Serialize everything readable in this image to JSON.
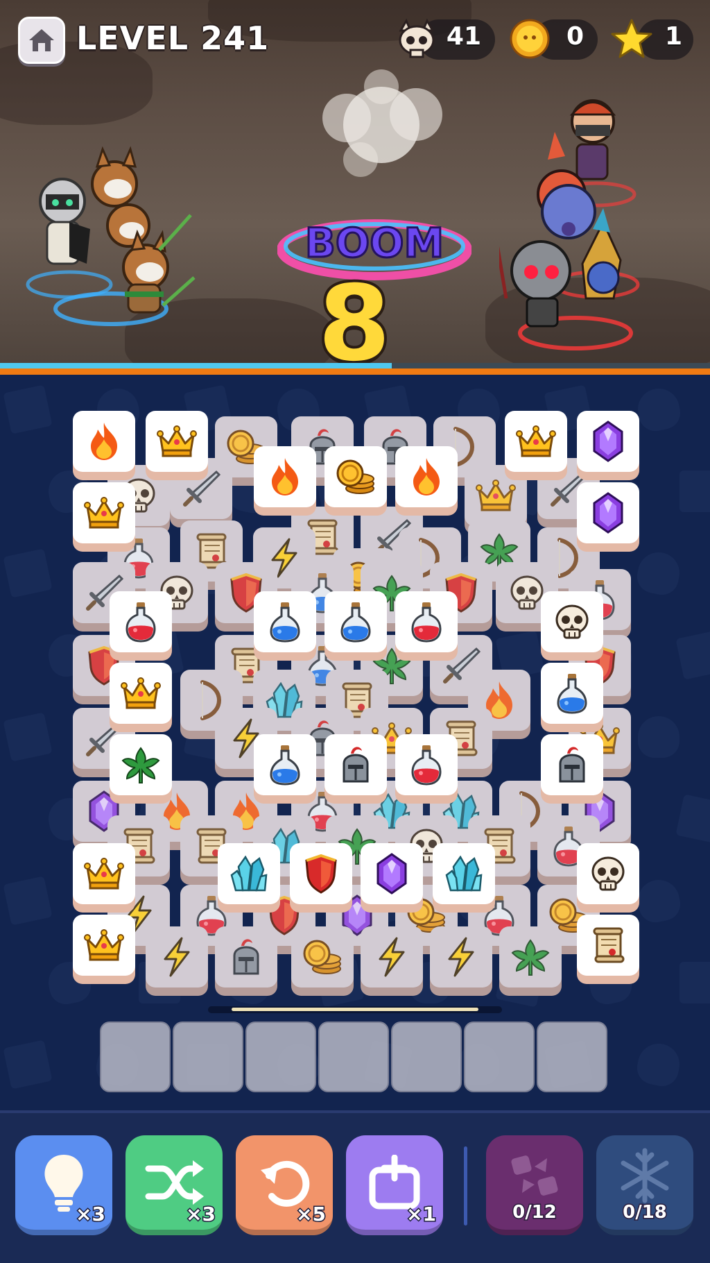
{
  "hud": {
    "level_label": "LEVEL 241",
    "skull_count": "41",
    "coin_count": "0",
    "star_count": "1"
  },
  "battle": {
    "wave_number": "8",
    "boom_text": "BOOM",
    "health_fraction": 0.62
  },
  "board": {
    "tiles": [
      {
        "icon": "skull-icon",
        "dim": true
      },
      {
        "icon": "sword-icon",
        "dim": true
      },
      {
        "icon": "coins-icon",
        "dim": true
      },
      {
        "icon": "helmet-icon",
        "dim": true
      },
      {
        "icon": "helmet-icon",
        "dim": true
      },
      {
        "icon": "bow-icon",
        "dim": true
      },
      {
        "icon": "crown-icon",
        "dim": true
      },
      {
        "icon": "sword-icon",
        "dim": true
      },
      {
        "icon": "potion-red-icon",
        "dim": true
      },
      {
        "icon": "scroll-icon",
        "dim": true
      },
      {
        "icon": "lightning-icon",
        "dim": true
      },
      {
        "icon": "scroll-icon",
        "dim": true
      },
      {
        "icon": "sword-icon",
        "dim": true
      },
      {
        "icon": "coins-icon",
        "dim": true
      },
      {
        "icon": "bow-icon",
        "dim": true
      },
      {
        "icon": "leaf-icon",
        "dim": true
      },
      {
        "icon": "bow-icon",
        "dim": true
      },
      {
        "icon": "sword-icon",
        "dim": true
      },
      {
        "icon": "skull-icon",
        "dim": true
      },
      {
        "icon": "shield-icon",
        "dim": true
      },
      {
        "icon": "potion-blue-icon",
        "dim": true
      },
      {
        "icon": "leaf-icon",
        "dim": true
      },
      {
        "icon": "shield-icon",
        "dim": true
      },
      {
        "icon": "skull-icon",
        "dim": true
      },
      {
        "icon": "potion-red-icon",
        "dim": true
      },
      {
        "icon": "shield-icon",
        "dim": true
      },
      {
        "icon": "scroll-icon",
        "dim": true
      },
      {
        "icon": "potion-blue-icon",
        "dim": true
      },
      {
        "icon": "leaf-icon",
        "dim": true
      },
      {
        "icon": "sword-icon",
        "dim": true
      },
      {
        "icon": "shield-icon",
        "dim": true
      },
      {
        "icon": "bow-icon",
        "dim": true
      },
      {
        "icon": "crystal-icon",
        "dim": true
      },
      {
        "icon": "scroll-icon",
        "dim": true
      },
      {
        "icon": "fire-icon",
        "dim": true
      },
      {
        "icon": "sword-icon",
        "dim": true
      },
      {
        "icon": "lightning-icon",
        "dim": true
      },
      {
        "icon": "helmet-icon",
        "dim": true
      },
      {
        "icon": "crown-icon",
        "dim": true
      },
      {
        "icon": "scroll-icon",
        "dim": true
      },
      {
        "icon": "crown-icon",
        "dim": true
      },
      {
        "icon": "gem-icon",
        "dim": true
      },
      {
        "icon": "fire-icon",
        "dim": true
      },
      {
        "icon": "fire-icon",
        "dim": true
      },
      {
        "icon": "potion-red-icon",
        "dim": true
      },
      {
        "icon": "crystal-icon",
        "dim": true
      },
      {
        "icon": "crystal-icon",
        "dim": true
      },
      {
        "icon": "bow-icon",
        "dim": true
      },
      {
        "icon": "gem-icon",
        "dim": true
      },
      {
        "icon": "scroll-icon",
        "dim": true
      },
      {
        "icon": "scroll-icon",
        "dim": true
      },
      {
        "icon": "crystal-icon",
        "dim": true
      },
      {
        "icon": "leaf-icon",
        "dim": true
      },
      {
        "icon": "skull-icon",
        "dim": true
      },
      {
        "icon": "scroll-icon",
        "dim": true
      },
      {
        "icon": "potion-red-icon",
        "dim": true
      },
      {
        "icon": "lightning-icon",
        "dim": true
      },
      {
        "icon": "potion-red-icon",
        "dim": true
      },
      {
        "icon": "shield-icon",
        "dim": true
      },
      {
        "icon": "gem-icon",
        "dim": true
      },
      {
        "icon": "coins-icon",
        "dim": true
      },
      {
        "icon": "potion-red-icon",
        "dim": true
      },
      {
        "icon": "coins-icon",
        "dim": true
      },
      {
        "icon": "lightning-icon",
        "dim": true
      },
      {
        "icon": "helmet-icon",
        "dim": true
      },
      {
        "icon": "coins-icon",
        "dim": true
      },
      {
        "icon": "lightning-icon",
        "dim": true
      },
      {
        "icon": "lightning-icon",
        "dim": true
      },
      {
        "icon": "leaf-icon",
        "dim": true
      },
      {
        "icon": "fire-icon",
        "dim": false
      },
      {
        "icon": "crown-icon",
        "dim": false
      },
      {
        "icon": "crown-icon",
        "dim": false
      },
      {
        "icon": "gem-icon",
        "dim": false
      },
      {
        "icon": "fire-icon",
        "dim": false
      },
      {
        "icon": "coins-icon",
        "dim": false
      },
      {
        "icon": "fire-icon",
        "dim": false
      },
      {
        "icon": "crown-icon",
        "dim": false
      },
      {
        "icon": "gem-icon",
        "dim": false
      },
      {
        "icon": "potion-red-icon",
        "dim": false
      },
      {
        "icon": "potion-blue-icon",
        "dim": false
      },
      {
        "icon": "potion-blue-icon",
        "dim": false
      },
      {
        "icon": "potion-red-icon",
        "dim": false
      },
      {
        "icon": "skull-icon",
        "dim": false
      },
      {
        "icon": "crown-icon",
        "dim": false
      },
      {
        "icon": "potion-blue-icon",
        "dim": false
      },
      {
        "icon": "leaf-icon",
        "dim": false
      },
      {
        "icon": "potion-blue-icon",
        "dim": false
      },
      {
        "icon": "helmet-icon",
        "dim": false
      },
      {
        "icon": "potion-red-icon",
        "dim": false
      },
      {
        "icon": "helmet-icon",
        "dim": false
      },
      {
        "icon": "crown-icon",
        "dim": false
      },
      {
        "icon": "crystal-icon",
        "dim": false
      },
      {
        "icon": "shield-icon",
        "dim": false
      },
      {
        "icon": "gem-icon",
        "dim": false
      },
      {
        "icon": "crystal-icon",
        "dim": false
      },
      {
        "icon": "skull-icon",
        "dim": false
      },
      {
        "icon": "crown-icon",
        "dim": false
      },
      {
        "icon": "scroll-icon",
        "dim": false
      }
    ],
    "tray_slots": 7
  },
  "powerups": {
    "hint": {
      "count": "×3",
      "color": "#5b8ef0"
    },
    "shuffle": {
      "count": "×3",
      "color": "#4fcc83"
    },
    "undo": {
      "count": "×5",
      "color": "#f2946a"
    },
    "add_slot": {
      "count": "×1",
      "color": "#9d7cf0"
    },
    "magnet": {
      "ratio": "0/12",
      "color": "#6a2e6e"
    },
    "freeze": {
      "ratio": "0/18",
      "color": "#2f4c7e"
    }
  }
}
